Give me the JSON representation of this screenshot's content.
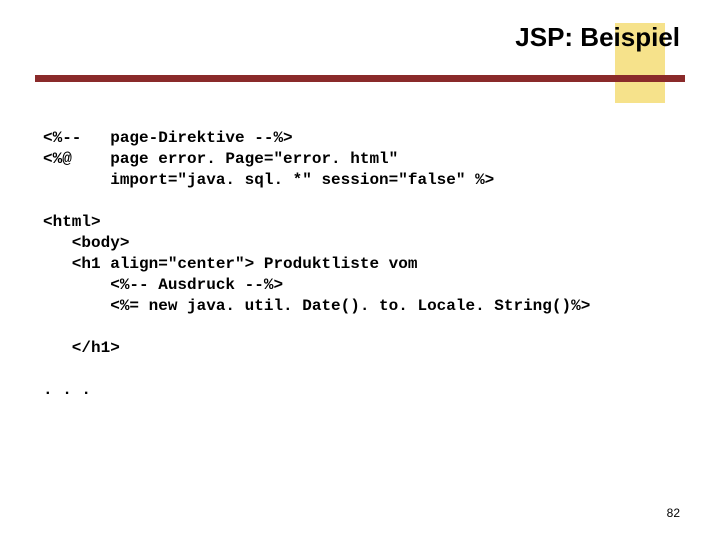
{
  "title": "JSP: Beispiel",
  "code": {
    "l1": "<%--   page-Direktive --%>",
    "l2": "<%@    page error. Page=\"error. html\"",
    "l3": "       import=\"java. sql. *\" session=\"false\" %>",
    "l4": "",
    "l5": "<html>",
    "l6": "   <body>",
    "l7": "   <h1 align=\"center\"> Produktliste vom",
    "l8": "       <%-- Ausdruck --%>",
    "l9": "       <%= new java. util. Date(). to. Locale. String()%>",
    "l10": "",
    "l11": "   </h1>",
    "l12": "",
    "l13": ". . ."
  },
  "page_number": "82",
  "colors": {
    "accent_bg": "#f6e28b",
    "rule": "#8a2a2a"
  }
}
